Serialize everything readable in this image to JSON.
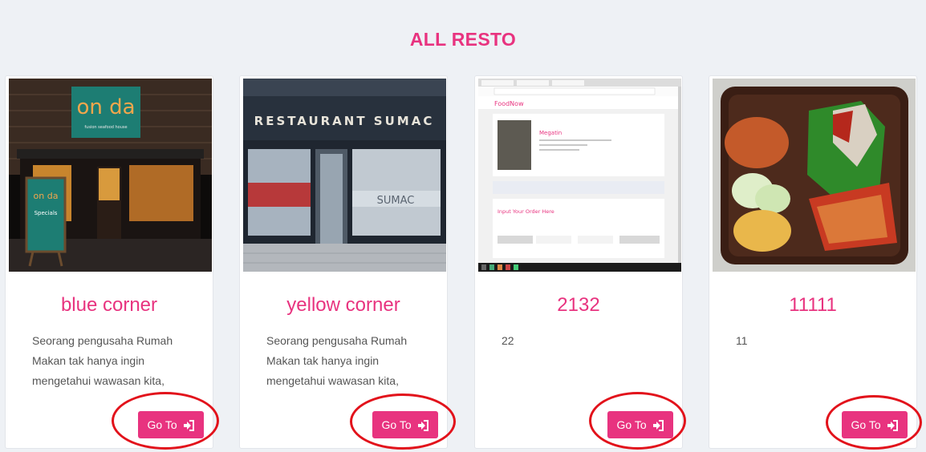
{
  "header": {
    "title": "ALL RESTO"
  },
  "restaurants": [
    {
      "name": "blue corner",
      "description": "Seorang pengusaha Rumah Makan tak hanya ingin mengetahui wawasan kita,",
      "button_label": "Go To"
    },
    {
      "name": "yellow corner",
      "description": "Seorang pengusaha Rumah Makan tak hanya ingin mengetahui wawasan kita,",
      "button_label": "Go To"
    },
    {
      "name": "2132",
      "description": "22",
      "button_label": "Go To"
    },
    {
      "name": "11111",
      "description": "11",
      "button_label": "Go To"
    }
  ],
  "images": {
    "onda": {
      "logo_text": "on da",
      "logo_subtext": "fusion seafood house",
      "board_title": "Specials"
    },
    "sumac": {
      "sign": "RESTAURANT SUMAC",
      "window_text": "SUMAC"
    },
    "screenshot": {
      "brand": "FoodNow",
      "resto": "Megatin",
      "order_heading": "Input Your Order Here"
    }
  },
  "colors": {
    "accent": "#e8337f",
    "annotation": "#e2121b"
  },
  "icons": {
    "go": "sign-in-icon"
  }
}
